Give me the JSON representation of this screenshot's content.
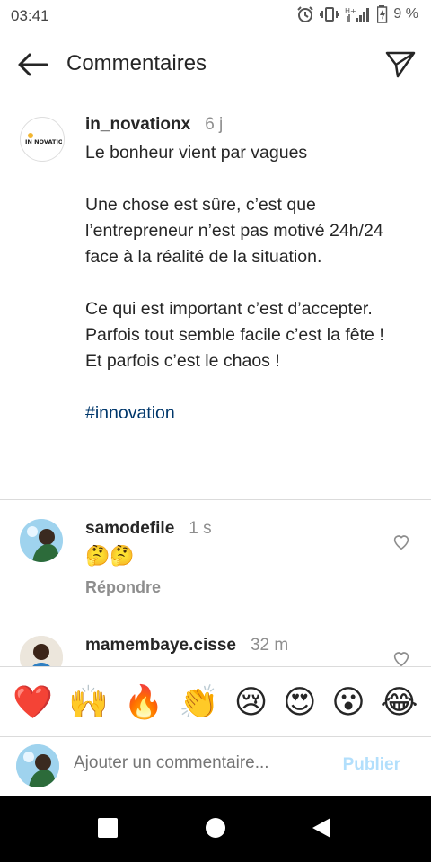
{
  "status_bar": {
    "time": "03:41",
    "battery": "9 %"
  },
  "header": {
    "title": "Commentaires"
  },
  "post": {
    "username": "in_novationx",
    "time": "6 j",
    "avatar_text": "IN NOVATION",
    "caption": {
      "line1": "Le bonheur vient par vagues",
      "para2": "Une chose est sûre, c’est que l’entrepreneur n’est pas motivé 24h/24 face à la réalité de la situation.",
      "para3": "Ce qui est important c’est d’accepter. Parfois tout semble facile c’est la fête !  Et parfois c’est le chaos !",
      "hashtag": "#innovation"
    }
  },
  "comments": [
    {
      "username": "samodefile",
      "time": "1 s",
      "text": "🤔🤔",
      "reply_label": "Répondre"
    },
    {
      "username": "mamembaye.cisse",
      "time": "32 m"
    }
  ],
  "emoji_bar": [
    "❤️",
    "🙌",
    "🔥",
    "👏",
    "😢",
    "😍",
    "😮",
    "😂"
  ],
  "comment_input": {
    "placeholder": "Ajouter un commentaire...",
    "publish_label": "Publier"
  },
  "colors": {
    "link": "#00376b",
    "publish_disabled": "#b2dffc",
    "secondary": "#8e8e8e"
  }
}
